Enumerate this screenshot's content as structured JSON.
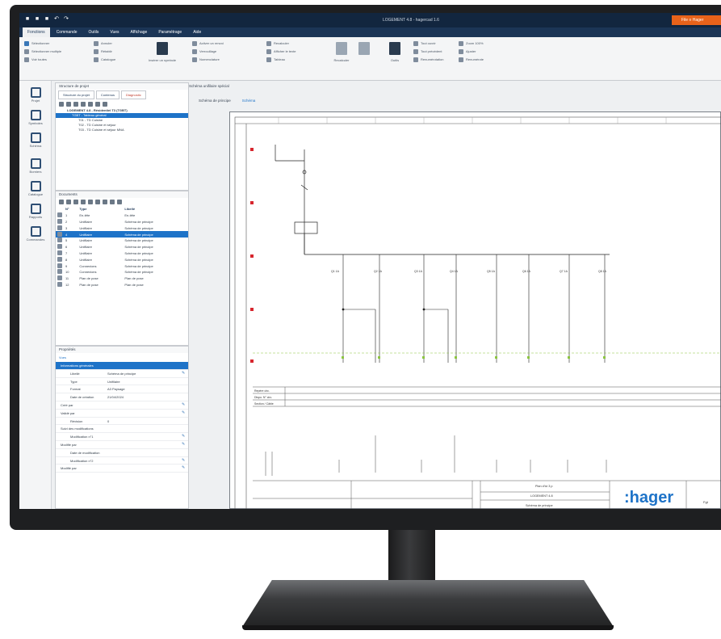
{
  "titlebar": {
    "window_title": "LOGEMENT 4.8 - hagercad 1.6",
    "orange_label": "File  ≡  Hager"
  },
  "menubar": {
    "items": [
      "Fonctions",
      "Commande",
      "Outils",
      "Vues",
      "Affichage",
      "Paramétrage",
      "Aide"
    ]
  },
  "ribbon": {
    "group1": [
      "Sélectionner",
      "Sélectionner multiple",
      "Voir toutes"
    ],
    "group2": [
      "Annuler",
      "Rétablir",
      "Catalogue"
    ],
    "big1_label": "Insérer un symbole",
    "group3": [
      "Activer un renvoi",
      "Verrouillage",
      "Nomenclature"
    ],
    "group4": [
      "Recalculer",
      "Afficher le texte",
      "Tableau"
    ],
    "big2_label": "Recalculer",
    "big3_label": "Outils",
    "group5": [
      "Tout ouvrir",
      "Tout précédent",
      "Renumérotation"
    ],
    "group6": [
      "Zoom 100%",
      "Ajuster",
      "Renumérote"
    ]
  },
  "rail": {
    "items": [
      "Projet",
      "Symboles",
      "Schéma",
      "Borniers",
      "Catalogue",
      "Rapports",
      "Commandes"
    ]
  },
  "structure": {
    "title": "Structure de projet",
    "tabs": [
      "Structure du projet",
      "Contenus",
      "Diagnostic"
    ],
    "tree": [
      "LOGEMENT 4.8 - Résidentiel T3 (TGBT)",
      "TGBT - Tableau général",
      "T01 - TD Cuisine",
      "T02 - TD Cuisine et séjour",
      "T03 - TD Cuisine et séjour MNA"
    ]
  },
  "documents": {
    "title": "Documents",
    "headers": [
      "N°",
      "Type",
      "Libellé"
    ],
    "rows": [
      [
        "1",
        "En-tête",
        "En-tête"
      ],
      [
        "2",
        "Unifilaire",
        "Schéma de principe"
      ],
      [
        "3",
        "Unifilaire",
        "Schéma de principe"
      ],
      [
        "4",
        "Unifilaire",
        "Schéma de principe"
      ],
      [
        "5",
        "Unifilaire",
        "Schéma de principe"
      ],
      [
        "6",
        "Unifilaire",
        "Schéma de principe"
      ],
      [
        "7",
        "Unifilaire",
        "Schéma de principe"
      ],
      [
        "8",
        "Unifilaire",
        "Schéma de principe"
      ],
      [
        "9",
        "Connexions",
        "Schéma de principe"
      ],
      [
        "10",
        "Connexions",
        "Schéma de principe"
      ],
      [
        "11",
        "Plan de pose",
        "Plan de pose"
      ],
      [
        "12",
        "Plan de pose",
        "Plan de pose"
      ]
    ]
  },
  "properties": {
    "title": "Propriétés",
    "link": "Vues",
    "group": "Informations générales",
    "rows": [
      [
        "Libellé",
        "Schéma de principe"
      ],
      [
        "Type",
        "Unifilaire"
      ],
      [
        "Format",
        "A3 Paysage"
      ],
      [
        "Date de création",
        "21/04/2024"
      ]
    ],
    "sub": [
      [
        "Créé par",
        ""
      ],
      [
        "Validé par",
        ""
      ],
      [
        "Révision",
        "0"
      ]
    ],
    "group2": "Suivi des modifications",
    "rows2": [
      "Modification n°1",
      "Modifié par",
      "Date de modification",
      "Modification n°2",
      "Modifié par"
    ]
  },
  "drawing": {
    "doc_tab": "Schéma unifilaire spécial",
    "sub_tabs": [
      "Schéma de principe",
      "Schéma"
    ],
    "brand": ":hager",
    "title_block": [
      "Plan d’ici 3 p",
      "LOGEMENT 4.8",
      "Schéma de principe"
    ],
    "row_labels": [
      "Repère circ.",
      "Dispo. N° circ.",
      "Section / Câble"
    ],
    "label_logo_tag": "Fgt"
  },
  "colors": {
    "titlebar": "#12263f",
    "menubar": "#1b3556",
    "accent_orange": "#e8621a",
    "selection_blue": "#1e73c8",
    "brand_blue": "#1e73c8"
  }
}
